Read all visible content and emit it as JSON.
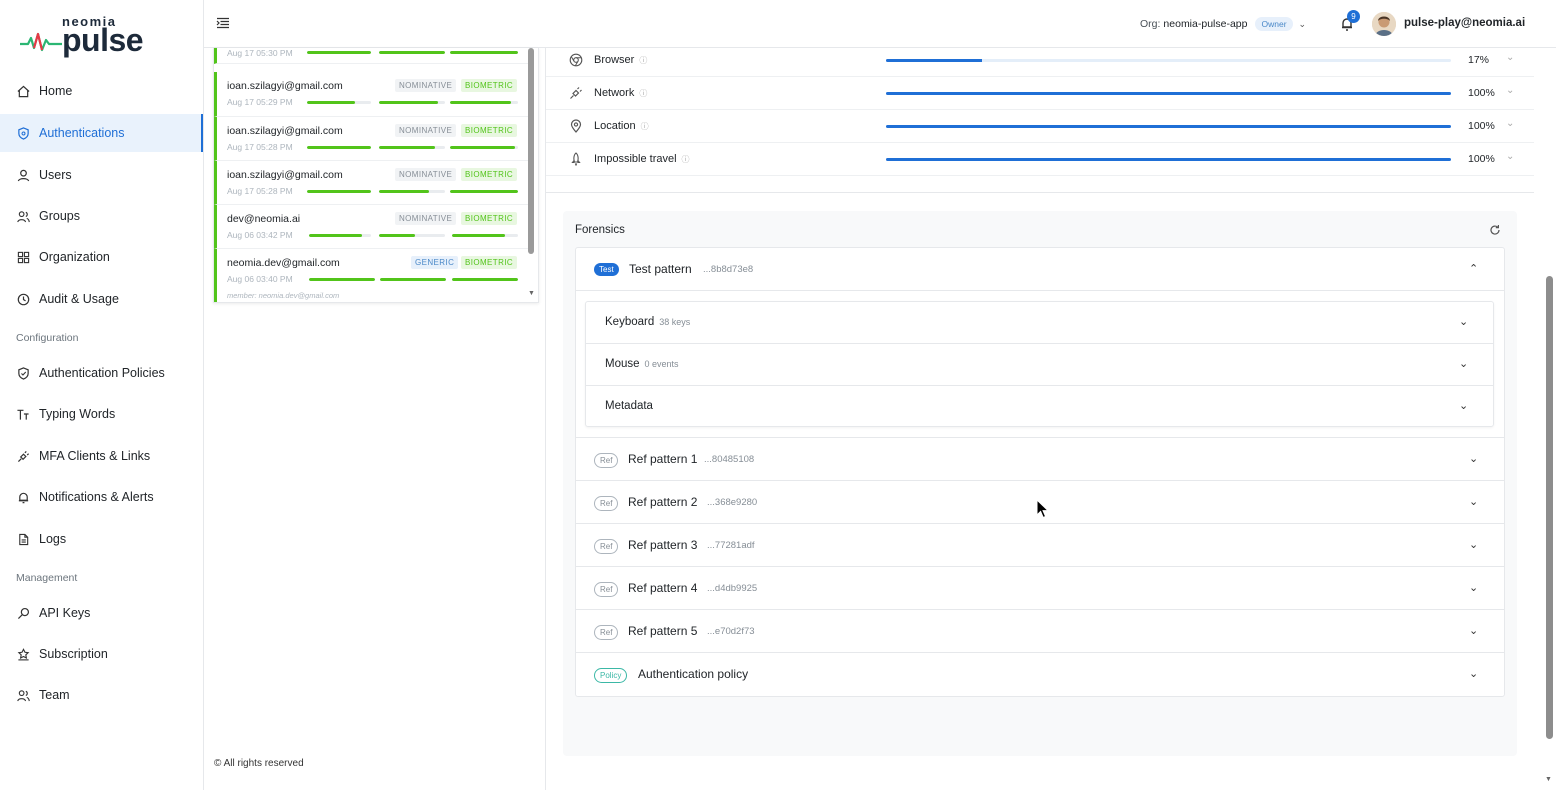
{
  "logo": {
    "top": "neomia",
    "main": "pulse"
  },
  "sidebar": {
    "items": [
      {
        "label": "Home",
        "icon": "home-icon"
      },
      {
        "label": "Authentications",
        "icon": "shield-check-icon",
        "active": true
      },
      {
        "label": "Users",
        "icon": "user-icon"
      },
      {
        "label": "Groups",
        "icon": "users-icon"
      },
      {
        "label": "Organization",
        "icon": "grid-icon"
      },
      {
        "label": "Audit & Usage",
        "icon": "clock-icon"
      }
    ],
    "config_heading": "Configuration",
    "config_items": [
      {
        "label": "Authentication Policies",
        "icon": "shield-icon"
      },
      {
        "label": "Typing Words",
        "icon": "text-size-icon"
      },
      {
        "label": "MFA Clients & Links",
        "icon": "plug-icon"
      },
      {
        "label": "Notifications & Alerts",
        "icon": "bell-icon"
      },
      {
        "label": "Logs",
        "icon": "file-icon"
      }
    ],
    "management_heading": "Management",
    "management_items": [
      {
        "label": "API Keys",
        "icon": "key-icon"
      },
      {
        "label": "Subscription",
        "icon": "badge-icon"
      },
      {
        "label": "Team",
        "icon": "team-icon"
      }
    ],
    "copyright": "© All rights reserved"
  },
  "header": {
    "org_label": "Org:",
    "org_name": "neomia-pulse-app",
    "role": "Owner",
    "notifications": "9",
    "user_email": "pulse-play@neomia.ai"
  },
  "auth_list": {
    "partial_date": "Aug 17 05:30 PM",
    "rows": [
      {
        "email": "ioan.szilagyi@gmail.com",
        "date": "Aug 17 05:29 PM",
        "type": "NOMINATIVE",
        "method": "BIOMETRIC",
        "scores": [
          0.75,
          0.9,
          0.9
        ]
      },
      {
        "email": "ioan.szilagyi@gmail.com",
        "date": "Aug 17 05:28 PM",
        "type": "NOMINATIVE",
        "method": "BIOMETRIC",
        "scores": [
          1.0,
          0.85,
          0.95
        ]
      },
      {
        "email": "ioan.szilagyi@gmail.com",
        "date": "Aug 17 05:28 PM",
        "type": "NOMINATIVE",
        "method": "BIOMETRIC",
        "scores": [
          1.0,
          0.75,
          1.0
        ]
      },
      {
        "email": "dev@neomia.ai",
        "date": "Aug 06 03:42 PM",
        "type": "NOMINATIVE",
        "method": "BIOMETRIC",
        "scores": [
          0.85,
          0.55,
          0.8
        ]
      },
      {
        "email": "neomia.dev@gmail.com",
        "date": "Aug 06 03:40 PM",
        "type": "GENERIC",
        "method": "BIOMETRIC",
        "scores": [
          1.0,
          1.0,
          1.0
        ],
        "member": "member: neomia.dev@gmail.com"
      }
    ]
  },
  "signals": [
    {
      "name": "Browser",
      "value": 0.17,
      "pct": "17%",
      "icon": "chrome-icon"
    },
    {
      "name": "Network",
      "value": 1.0,
      "pct": "100%",
      "icon": "plug-icon"
    },
    {
      "name": "Location",
      "value": 1.0,
      "pct": "100%",
      "icon": "map-pin-icon"
    },
    {
      "name": "Impossible travel",
      "value": 1.0,
      "pct": "100%",
      "icon": "rocket-icon"
    }
  ],
  "forensics": {
    "title": "Forensics",
    "test": {
      "badge": "Test",
      "title": "Test pattern",
      "hash": "...8b8d73e8"
    },
    "test_sections": [
      {
        "title": "Keyboard",
        "meta": "38 keys"
      },
      {
        "title": "Mouse",
        "meta": "0 events"
      },
      {
        "title": "Metadata",
        "meta": ""
      }
    ],
    "refs": [
      {
        "badge": "Ref",
        "title": "Ref pattern 1",
        "hash": "...80485108"
      },
      {
        "badge": "Ref",
        "title": "Ref pattern 2",
        "hash": "...368e9280"
      },
      {
        "badge": "Ref",
        "title": "Ref pattern 3",
        "hash": "...77281adf"
      },
      {
        "badge": "Ref",
        "title": "Ref pattern 4",
        "hash": "...d4db9925"
      },
      {
        "badge": "Ref",
        "title": "Ref pattern 5",
        "hash": "...e70d2f73"
      }
    ],
    "policy": {
      "badge": "Policy",
      "title": "Authentication policy"
    }
  },
  "colors": {
    "accent": "#1f6fd6",
    "success": "#52c41a",
    "teal": "#3bb8a6"
  }
}
